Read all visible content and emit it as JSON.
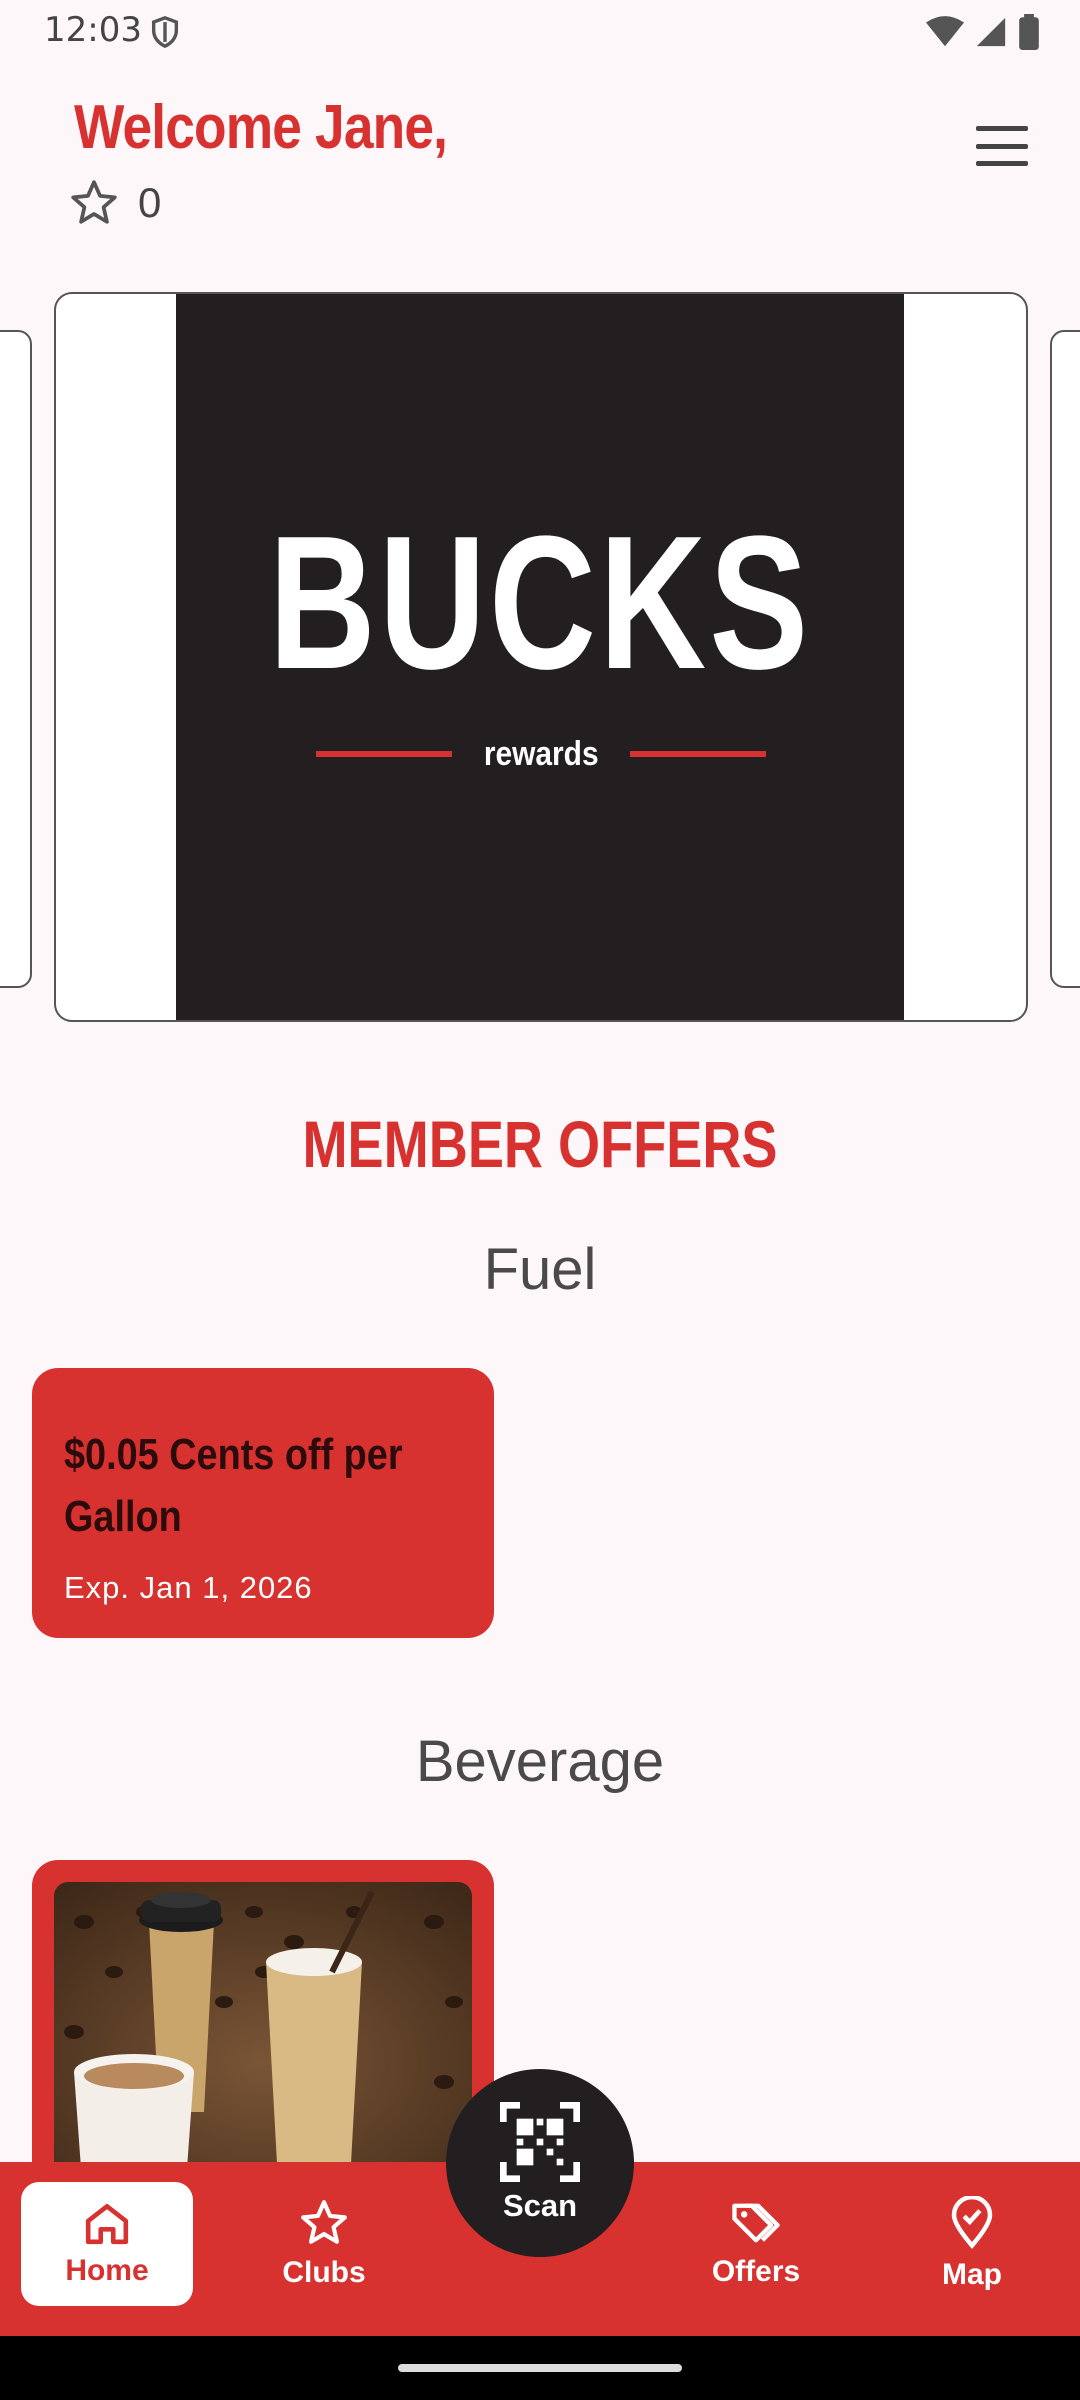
{
  "status_bar": {
    "time": "12:03"
  },
  "header": {
    "welcome": "Welcome Jane,",
    "points": "0"
  },
  "carousel": {
    "brand": "BUCKS",
    "tagline": "rewards"
  },
  "offers": {
    "section_title": "MEMBER OFFERS",
    "categories": [
      {
        "name": "Fuel",
        "items": [
          {
            "title": "$0.05 Cents off per Gallon",
            "expiry": "Exp. Jan 1, 2026"
          }
        ]
      },
      {
        "name": "Beverage",
        "items": [
          {
            "image": "coffee-cups-photo"
          }
        ]
      }
    ]
  },
  "bottom_nav": {
    "items": [
      {
        "label": "Home",
        "icon": "home-icon",
        "active": true
      },
      {
        "label": "Clubs",
        "icon": "star-icon"
      },
      {
        "label": "Offers",
        "icon": "tag-icon"
      },
      {
        "label": "Map",
        "icon": "map-pin-icon"
      }
    ],
    "scan_label": "Scan"
  },
  "colors": {
    "brand_red": "#d7322f",
    "dark": "#231f20",
    "background": "#fdf7fa"
  }
}
